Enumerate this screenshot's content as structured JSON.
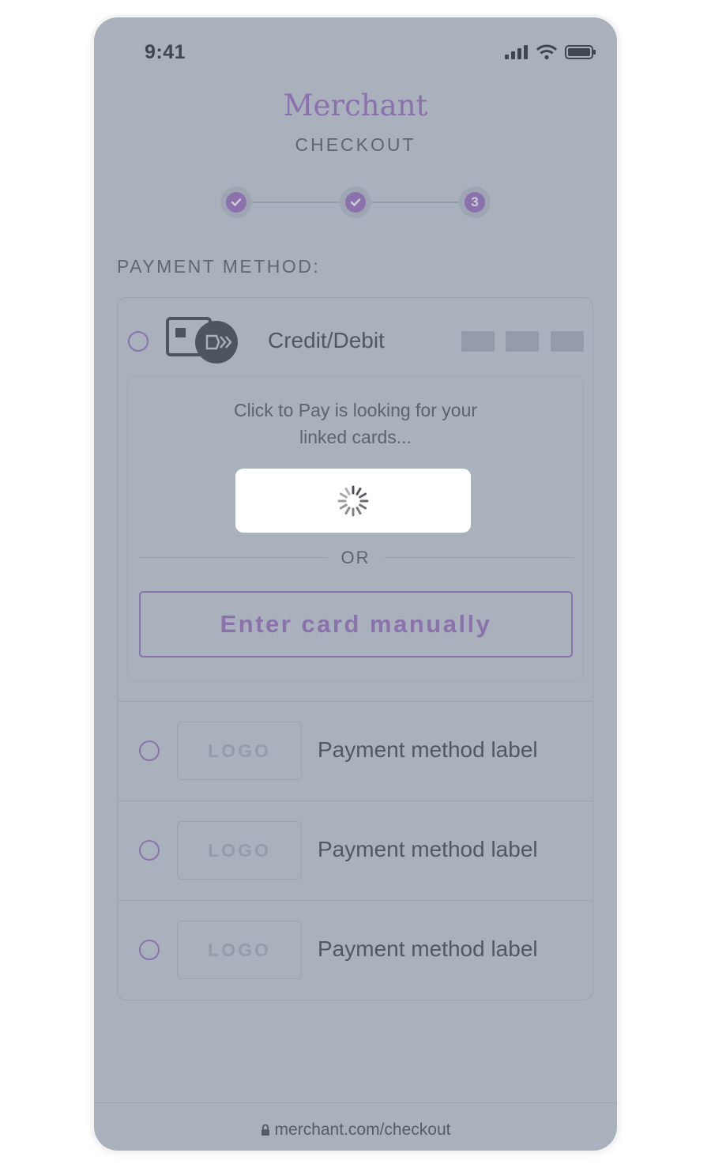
{
  "status_bar": {
    "time": "9:41"
  },
  "header": {
    "brand": "Merchant",
    "subtitle": "CHECKOUT"
  },
  "stepper": {
    "steps": [
      {
        "state": "done"
      },
      {
        "state": "done"
      },
      {
        "state": "current",
        "label": "3"
      }
    ]
  },
  "payment": {
    "title": "PAYMENT METHOD:",
    "credit_debit": {
      "label": "Credit/Debit",
      "click_to_pay_line1": "Click to Pay is looking for your",
      "click_to_pay_line2": "linked cards...",
      "or_text": "OR",
      "manual_button": "Enter card manually"
    },
    "methods": [
      {
        "logo": "LOGO",
        "label": "Payment method label"
      },
      {
        "logo": "LOGO",
        "label": "Payment method label"
      },
      {
        "logo": "LOGO",
        "label": "Payment method label"
      }
    ]
  },
  "footer": {
    "url": "merchant.com/checkout",
    "icon": "lock-icon"
  },
  "colors": {
    "accent": "#8b72ad",
    "overlay": "#a8b1bc"
  }
}
